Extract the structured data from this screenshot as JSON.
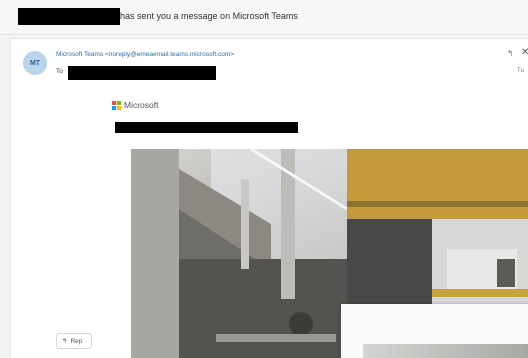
{
  "subject": {
    "text": "has sent you a message on Microsoft Teams"
  },
  "email": {
    "avatar_initials": "MT",
    "sender": "Microsoft Teams <noreply@emeaemail.teams.microsoft.com>",
    "to_label": "To",
    "date_fragment": "Tu",
    "reply_label": "Rep"
  },
  "logo": {
    "text": "Microsoft",
    "colors": [
      "#f25022",
      "#7fba00",
      "#00a4ef",
      "#ffb900"
    ]
  },
  "icons": {
    "reply": "↰",
    "close": "✕",
    "reply_button": "↰"
  }
}
